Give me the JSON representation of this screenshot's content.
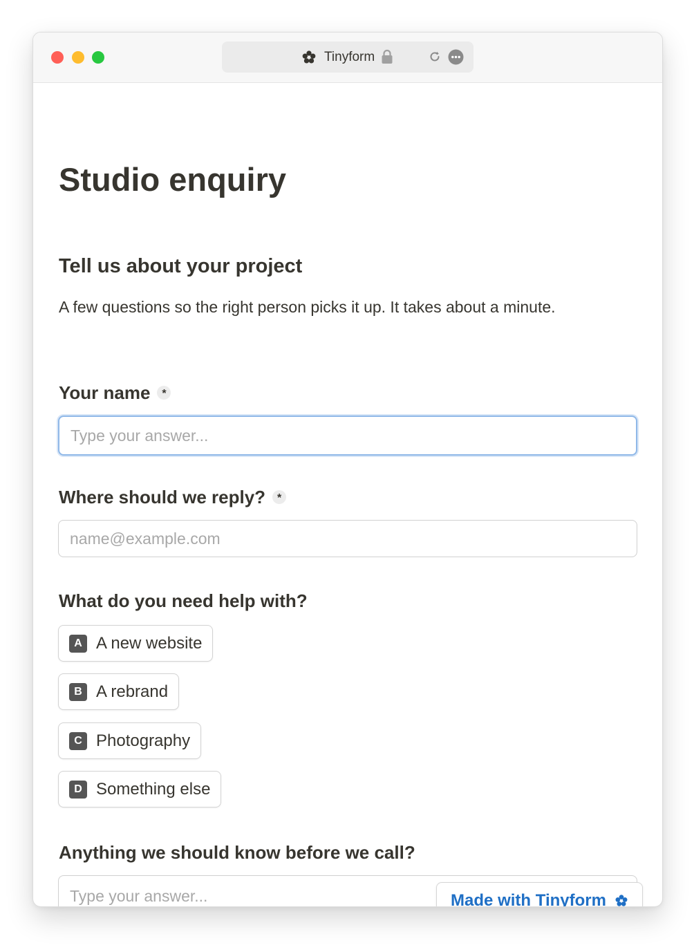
{
  "browser": {
    "tab_title": "Tinyform"
  },
  "form": {
    "title": "Studio enquiry",
    "section_title": "Tell us about your project",
    "section_description": "A few questions so the right person picks it up. It takes about a minute.",
    "questions": [
      {
        "label": "Your name",
        "required_marker": "*",
        "placeholder": "Type your answer...",
        "value": ""
      },
      {
        "label": "Where should we reply?",
        "required_marker": "*",
        "placeholder": "name@example.com",
        "value": ""
      },
      {
        "label": "What do you need help with?",
        "choices": [
          {
            "key": "A",
            "label": "A new website"
          },
          {
            "key": "B",
            "label": "A rebrand"
          },
          {
            "key": "C",
            "label": "Photography"
          },
          {
            "key": "D",
            "label": "Something else"
          }
        ]
      },
      {
        "label": "Anything we should know before we call?",
        "placeholder": "Type your answer...",
        "value": ""
      }
    ]
  },
  "badge": {
    "label": "Made with Tinyform"
  },
  "icons": {
    "logo": "tinyform-flower-icon",
    "lock": "lock-icon",
    "reload": "reload-icon",
    "more": "more-icon"
  },
  "colors": {
    "text": "#37352f",
    "focus_ring": "#8fb8e8",
    "badge_blue": "#1f6fc5",
    "choice_key_bg": "#555555"
  }
}
